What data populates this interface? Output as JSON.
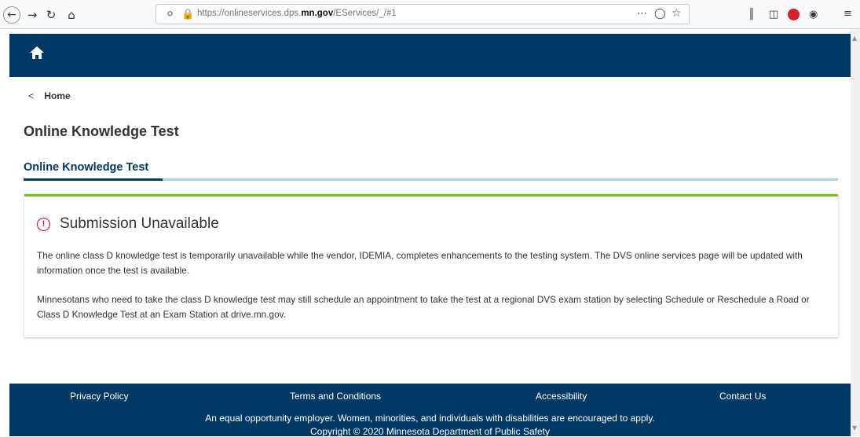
{
  "browser": {
    "url_prefix": "https://onlineservices.dps.",
    "url_domain": "mn.gov",
    "url_suffix": "/EServices/_/#1",
    "ellipsis": "⋯"
  },
  "breadcrumb": {
    "chevron": "<",
    "label": "Home"
  },
  "page": {
    "title": "Online Knowledge Test",
    "tab_label": "Online Knowledge Test"
  },
  "card": {
    "title": "Submission Unavailable",
    "p1": "The online class D knowledge test is temporarily unavailable while the vendor, IDEMIA, completes enhancements to the testing system. The DVS online services page will be updated with information once the test is available.",
    "p2": "Minnesotans who need to take the class D knowledge test may still schedule an appointment to take the test at a regional DVS exam station by selecting Schedule or Reschedule a Road or Class D Knowledge Test at an Exam Station at drive.mn.gov."
  },
  "footer": {
    "links": [
      "Privacy Policy",
      "Terms and Conditions",
      "Accessibility",
      "Contact Us"
    ],
    "note": "An equal opportunity employer. Women, minorities, and individuals with disabilities are encouraged to apply.",
    "copyright": "Copyright © 2020 Minnesota Department of Public Safety"
  },
  "colors": {
    "navy": "#003865",
    "green": "#78be20",
    "alert_red": "#c8102e",
    "tab_light": "#a8d1ed"
  },
  "icons": [
    "back-arrow-icon",
    "forward-arrow-icon",
    "reload-icon",
    "home-icon",
    "shield-icon",
    "lock-icon",
    "page-actions-icon",
    "pocket-icon",
    "bookmark-star-icon",
    "library-icon",
    "sidebar-icon",
    "adblock-icon",
    "account-icon",
    "menu-icon",
    "home-icon",
    "alert-circle-icon"
  ]
}
